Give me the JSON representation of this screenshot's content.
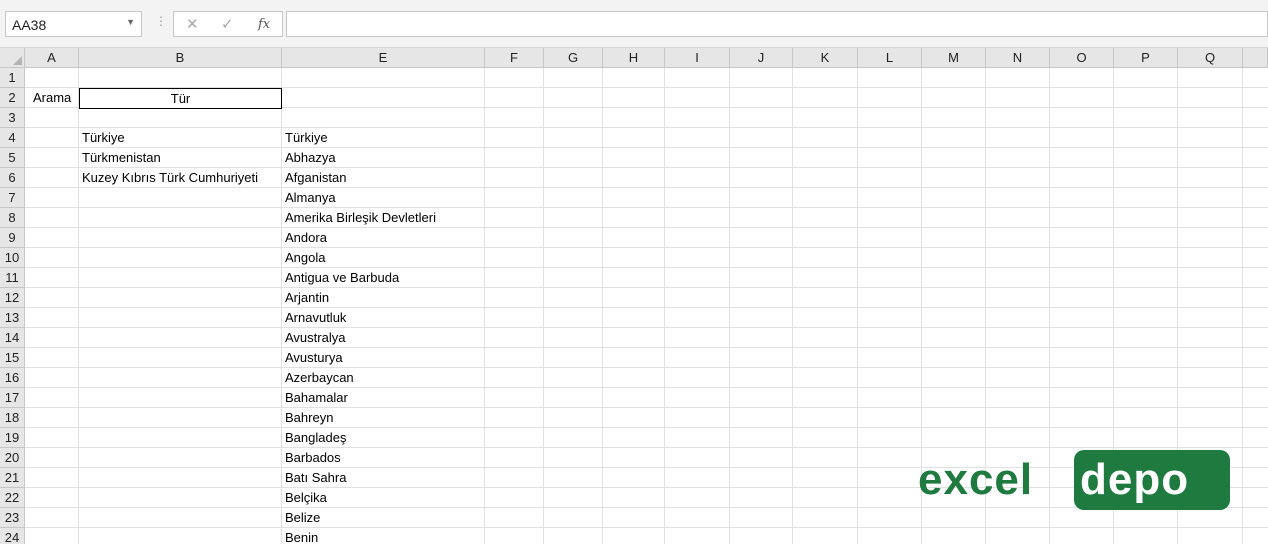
{
  "formula_bar": {
    "name_box": "AA38",
    "separator": "⋮",
    "cancel_glyph": "✕",
    "enter_glyph": "✓",
    "fx_label": "fx",
    "formula_value": ""
  },
  "columns": [
    "A",
    "B",
    "E",
    "F",
    "G",
    "H",
    "I",
    "J",
    "K",
    "L",
    "M",
    "N",
    "O",
    "P",
    "Q"
  ],
  "rows": [
    "1",
    "2",
    "3",
    "4",
    "5",
    "6",
    "7",
    "8",
    "9",
    "10",
    "11",
    "12",
    "13",
    "14",
    "15",
    "16",
    "17",
    "18",
    "19",
    "20",
    "21",
    "22",
    "23",
    "24"
  ],
  "cells": {
    "a2": "Arama",
    "b2": "Tür",
    "b_results": [
      "Türkiye",
      "Türkmenistan",
      "Kuzey Kıbrıs Türk Cumhuriyeti"
    ],
    "e_list": [
      "Türkiye",
      "Abhazya",
      "Afganistan",
      "Almanya",
      "Amerika Birleşik Devletleri",
      "Andora",
      "Angola",
      "Antigua ve Barbuda",
      "Arjantin",
      "Arnavutluk",
      "Avustralya",
      "Avusturya",
      "Azerbaycan",
      "Bahamalar",
      "Bahreyn",
      "Bangladeş",
      "Barbados",
      "Batı Sahra",
      "Belçika",
      "Belize",
      "Benin"
    ]
  },
  "logo": {
    "left_text": "excel",
    "right_text": "depo",
    "brand_color": "#1f7a3f"
  }
}
